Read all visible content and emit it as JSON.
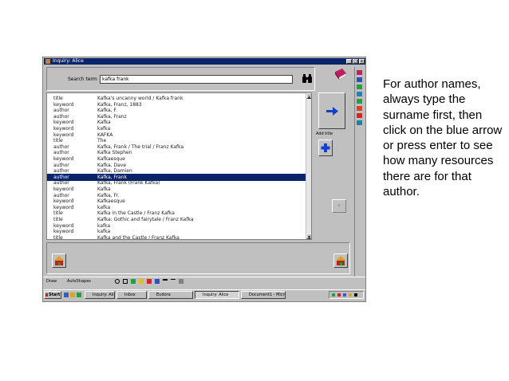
{
  "window": {
    "title": "Inquiry: Alice"
  },
  "search": {
    "label": "Search term",
    "value": "kafka frank"
  },
  "list": {
    "rows": [
      {
        "field": "title",
        "value": "Kafka's uncanny world / Kafka frank"
      },
      {
        "field": "keyword",
        "value": "Kafka, Franz, 1883"
      },
      {
        "field": "author",
        "value": "Kafka, F."
      },
      {
        "field": "author",
        "value": "Kafka, Franz"
      },
      {
        "field": "keyword",
        "value": "Kafka"
      },
      {
        "field": "keyword",
        "value": "kafka"
      },
      {
        "field": "keyword",
        "value": "KAFKA"
      },
      {
        "field": "title",
        "value": "The"
      },
      {
        "field": "author",
        "value": "Kafka, Frank / The trial / Franz Kafka"
      },
      {
        "field": "author",
        "value": "Kafka Stephen"
      },
      {
        "field": "keyword",
        "value": "Kafkaesque"
      },
      {
        "field": "author",
        "value": "Kafka, Dave"
      },
      {
        "field": "author",
        "value": "Kafka, Damien"
      },
      {
        "field": "author",
        "value": "Kafka, Frank"
      },
      {
        "field": "author",
        "value": "Kafka, Frank (Frank Kafka)"
      },
      {
        "field": "keyword",
        "value": "Kafka"
      },
      {
        "field": "author",
        "value": "Kafka, Fr."
      },
      {
        "field": "keyword",
        "value": "Kafkaesque"
      },
      {
        "field": "keyword",
        "value": "kafka"
      },
      {
        "field": "title",
        "value": "Kafka in the Castle / Franz Kafka"
      },
      {
        "field": "title",
        "value": "Kafka: Gothic and fairytale / Franz Kafka"
      },
      {
        "field": "keyword",
        "value": "kafka"
      },
      {
        "field": "keyword",
        "value": "kafka"
      },
      {
        "field": "title",
        "value": "Kafka and the Castle / Franz Kafka"
      }
    ],
    "selected_index": 13
  },
  "side": {
    "label": "Add title",
    "dim_button": "+"
  },
  "drawbar": {
    "draw_label": "Draw",
    "autoshapes_label": "AutoShapes"
  },
  "taskbar": {
    "start_label": "Start",
    "tasks": [
      "Inquiry: Alice",
      "Inbox",
      "Eudora",
      "Inquiry: Alice",
      "Document1 - Micros..."
    ]
  },
  "instructions": "For author names, always type the surname first, then click on the blue arrow or press enter to see how many resources there are for that author.",
  "colors": {
    "selection": "#0a246a",
    "title_bar": "#0a246a",
    "window": "#c0c0c0",
    "arrow": "#1040d0"
  },
  "icons": [
    "binoculars-icon",
    "book-icon",
    "arrow-right-icon",
    "plus-icon",
    "house-icon",
    "windows-flag-icon"
  ]
}
